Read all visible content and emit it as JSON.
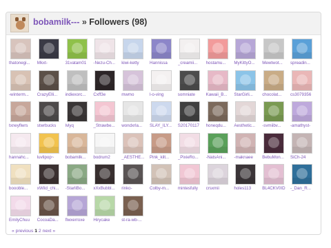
{
  "header": {
    "username": "bobamilk---",
    "separator": " » ",
    "title": "Followers (98)"
  },
  "followers": [
    {
      "name": "thatonegi...",
      "color": "#d8c4bd"
    },
    {
      "name": "Mkxt-",
      "color": "#3a3a46"
    },
    {
      "name": "31vatam01",
      "color": "#8fc14a"
    },
    {
      "name": "-Nezu-Ch...",
      "color": "#efe4e8"
    },
    {
      "name": "kiwi-ketty",
      "color": "#c7d6ec"
    },
    {
      "name": "Hannissa",
      "color": "#8c86c9"
    },
    {
      "name": "_creamii...",
      "color": "#f3f0f0"
    },
    {
      "name": "hostamu...",
      "color": "#f29b9b"
    },
    {
      "name": "MyKittyO...",
      "color": "#b7a7d7"
    },
    {
      "name": "Mewtwot...",
      "color": "#c7c7c7"
    },
    {
      "name": "spreadin...",
      "color": "#5aa0d8"
    },
    {
      "name": "-winterm...",
      "color": "#d8c2b4"
    },
    {
      "name": "CrazyElli...",
      "color": "#5c5048"
    },
    {
      "name": "indiexorc...",
      "color": "#bfbfbf"
    },
    {
      "name": "Cxff3e",
      "color": "#2d2628"
    },
    {
      "name": "mwmo",
      "color": "#d6c3da"
    },
    {
      "name": "l-o-ving",
      "color": "#f4f1f1"
    },
    {
      "name": "somniate",
      "color": "#4c4c4c"
    },
    {
      "name": "Kawaii_B...",
      "color": "#e7b9c7"
    },
    {
      "name": "StarGirli...",
      "color": "#8cc4e8"
    },
    {
      "name": "chocolat...",
      "color": "#c9ac86"
    },
    {
      "name": "cs3079356",
      "color": "#eab7b7"
    },
    {
      "name": "txneyflwrs",
      "color": "#c7a79b"
    },
    {
      "name": "stwrbucks",
      "color": "#4d4a4a"
    },
    {
      "name": "lvlyq",
      "color": "#3a3636"
    },
    {
      "name": "_Strawbe...",
      "color": "#f4c6d2"
    },
    {
      "name": "wondxrla...",
      "color": "#e6e6e6"
    },
    {
      "name": "SLAY_ILY...",
      "color": "#cdd9ee"
    },
    {
      "name": "S20170117",
      "color": "#404040"
    },
    {
      "name": "honeqdu...",
      "color": "#7c6a5c"
    },
    {
      "name": "Aesthetic...",
      "color": "#e3d7d7"
    },
    {
      "name": "-svmiibv...",
      "color": "#7a9a52"
    },
    {
      "name": "-amathyst-",
      "color": "#bea9dc"
    },
    {
      "name": "hannahc...",
      "color": "#f5e9ef"
    },
    {
      "name": "luvlipop~",
      "color": "#f2c34f"
    },
    {
      "name": "bobamilk...",
      "color": "#d9b79a"
    },
    {
      "name": "bodrum2",
      "color": "#f6f6f6"
    },
    {
      "name": "_AESTHE...",
      "color": "#dbc2b9"
    },
    {
      "name": "Pink_kilt...",
      "color": "#c79b87"
    },
    {
      "name": "_PixieRo...",
      "color": "#f2dde5"
    },
    {
      "name": "-NatsAni...",
      "color": "#5aa05a"
    },
    {
      "name": "-maknaee",
      "color": "#d0b3b3"
    },
    {
      "name": "BebuMon...",
      "color": "#4a2b3b"
    },
    {
      "name": "SiCh-24",
      "color": "#c4b4b4"
    },
    {
      "name": "boooble...",
      "color": "#f0e0c0"
    },
    {
      "name": "xWild_chi...",
      "color": "#3a3030"
    },
    {
      "name": "-StarliBo...",
      "color": "#8aa884"
    },
    {
      "name": "xXxBubbl...",
      "color": "#382f2f"
    },
    {
      "name": "rinko-",
      "color": "#5a5454"
    },
    {
      "name": "Colby-m...",
      "color": "#d2c2b7"
    },
    {
      "name": "mintesfully",
      "color": "#f1c7d4"
    },
    {
      "name": "crsxmii",
      "color": "#dcd4dc"
    },
    {
      "name": "holes113",
      "color": "#3b3538"
    },
    {
      "name": "BL4CKV0ID",
      "color": "#e3bfd2"
    },
    {
      "name": "-_Dan_R...",
      "color": "#2f6f9a"
    },
    {
      "name": "EmilyChuu",
      "color": "#f3dbea"
    },
    {
      "name": "CocoaDa...",
      "color": "#6a5448"
    },
    {
      "name": "flwxerroxe",
      "color": "#b6a6d6"
    },
    {
      "name": "Hirycake",
      "color": "#b8d8a8"
    },
    {
      "name": "st-ra-wb-...",
      "color": "#7a6050"
    }
  ],
  "pagination": {
    "prev": "« previous",
    "current": "1",
    "page2": "2",
    "next": "next »"
  }
}
